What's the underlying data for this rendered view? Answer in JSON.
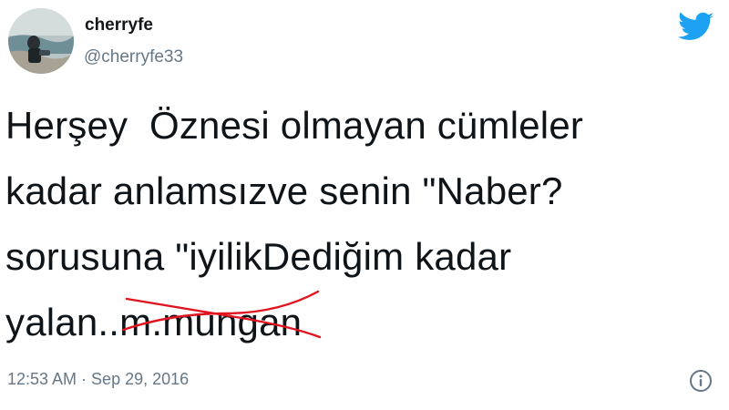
{
  "tweet": {
    "display_name": "cherryfe",
    "handle": "@cherryfe33",
    "text_lines": [
      "Herşey  Öznesi olmayan cümleler",
      "kadar anlamsızve senin \"Naber?",
      "sorusuna \"iyilikDediğim kadar"
    ],
    "last_line_prefix": "yalan..",
    "last_line_struck": "m.mungan",
    "timestamp": "12:53 AM · Sep 29, 2016"
  },
  "icons": {
    "avatar": "profile-photo",
    "brand": "twitter-bird-icon",
    "info": "info-icon"
  },
  "colors": {
    "brand_blue": "#1da1f2",
    "strike_red": "#e0141e",
    "secondary_text": "#657786"
  }
}
